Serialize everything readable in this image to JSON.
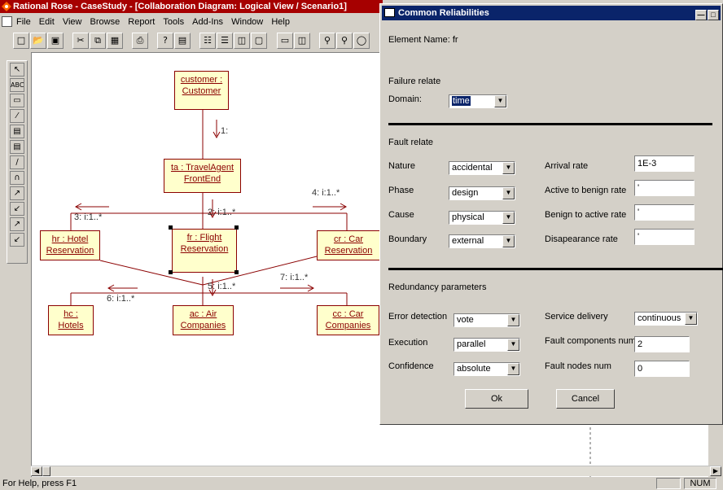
{
  "app": {
    "title": "Rational Rose - CaseStudy - [Collaboration Diagram: Logical View / Scenario1]",
    "status": "For Help, press F1",
    "num_indicator": "NUM"
  },
  "menu": [
    "File",
    "Edit",
    "View",
    "Browse",
    "Report",
    "Tools",
    "Add-Ins",
    "Window",
    "Help"
  ],
  "toolbar": {
    "icons": [
      "new-icon",
      "open-icon",
      "save-icon",
      "cut-icon",
      "copy-icon",
      "paste-icon",
      "print-icon",
      "context-help-icon",
      "browser-icon",
      "documentation-icon",
      "log-icon",
      "class-icon",
      "component-icon",
      "zoom-in-icon",
      "zoom-out-icon",
      "fit-icon"
    ]
  },
  "left_tools": {
    "icons": [
      "pointer-icon",
      "text-icon",
      "note-icon",
      "anchor-icon",
      "object-icon",
      "class-instance-icon",
      "link-icon",
      "self-link-icon",
      "message-icon",
      "reverse-message-icon",
      "data-token-icon",
      "reverse-data-token-icon"
    ],
    "text_tool": "ABC"
  },
  "diagram": {
    "objects": [
      {
        "line1": "customer :",
        "line2": "Customer"
      },
      {
        "line1": "ta : TravelAgent",
        "line2": "FrontEnd"
      },
      {
        "line1": "hr : Hotel",
        "line2": "Reservation"
      },
      {
        "line1": "fr : Flight",
        "line2": "Reservation"
      },
      {
        "line1": "cr : Car",
        "line2": "Reservation"
      },
      {
        "line1": "hc :",
        "line2": "Hotels"
      },
      {
        "line1": "ac : Air",
        "line2": "Companies"
      },
      {
        "line1": "cc : Car",
        "line2": "Companies"
      }
    ],
    "messages": [
      "1:",
      "2: i:1..*",
      "3: i:1..*",
      "4: i:1..*",
      "5: i:1..*",
      "6: i:1..*",
      "7: i:1..*"
    ]
  },
  "dialog": {
    "title": "Common Reliabilities",
    "element_name": "Element Name: fr",
    "failure_relate": "Failure relate",
    "domain_label": "Domain:",
    "domain_value": "time",
    "fault_relate": "Fault relate",
    "nature_label": "Nature",
    "nature_value": "accidental",
    "phase_label": "Phase",
    "phase_value": "design",
    "cause_label": "Cause",
    "cause_value": "physical",
    "boundary_label": "Boundary",
    "boundary_value": "external",
    "arrival_label": "Arrival rate",
    "arrival_value": "1E-3",
    "a2b_label": "Active to benign rate",
    "a2b_value": "'",
    "b2a_label": "Benign to active rate",
    "b2a_value": "'",
    "disap_label": "Disapearance rate",
    "disap_value": "'",
    "redundancy": "Redundancy parameters",
    "error_det_label": "Error detection",
    "error_det_value": "vote",
    "execution_label": "Execution",
    "execution_value": "parallel",
    "confidence_label": "Confidence",
    "confidence_value": "absolute",
    "service_label": "Service delivery",
    "service_value": "continuous",
    "fcomp_label": "Fault components num",
    "fcomp_value": "2",
    "fnodes_label": "Fault nodes num",
    "fnodes_value": "0",
    "ok": "Ok",
    "cancel": "Cancel"
  }
}
